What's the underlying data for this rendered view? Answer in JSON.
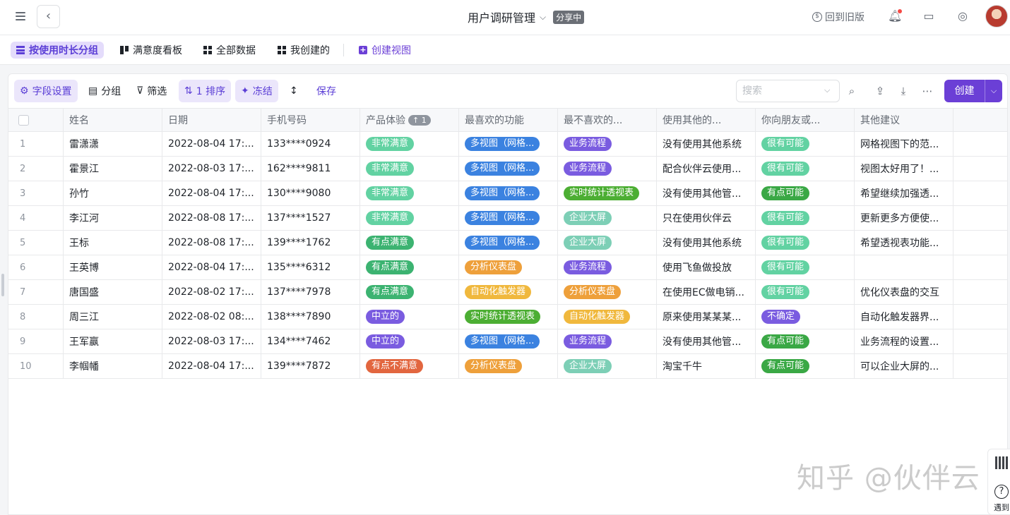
{
  "header": {
    "title": "用户调研管理",
    "share_badge": "分享中",
    "old_version": "回到旧版"
  },
  "views": [
    {
      "label": "按使用时长分组",
      "icon": "grid-icon",
      "active": true
    },
    {
      "label": "满意度看板",
      "icon": "kanban-icon",
      "active": false
    },
    {
      "label": "全部数据",
      "icon": "table-icon",
      "active": false
    },
    {
      "label": "我创建的",
      "icon": "table-icon",
      "active": false
    },
    {
      "label": "创建视图",
      "icon": "plus-icon",
      "active": false
    }
  ],
  "toolbar": {
    "field_settings": "字段设置",
    "group": "分组",
    "filter": "筛选",
    "sort": "1 排序",
    "freeze": "冻结",
    "save": "保存",
    "search_placeholder": "搜索",
    "create": "创建"
  },
  "columns": [
    "姓名",
    "日期",
    "手机号码",
    "产品体验",
    "最喜欢的功能",
    "最不喜欢的...",
    "使用其他的...",
    "你向朋友或...",
    "其他建议"
  ],
  "sort_badge": "↑ 1",
  "tag_colors": {
    "非常满意": "#62d2a2",
    "有点满意": "#3cb371",
    "中立的": "#7a5ce0",
    "有点不满意": "#e2663f",
    "多视图（网格...": "#3b82e0",
    "分析仪表盘": "#eea03b",
    "实时统计透视表": "#4cae33",
    "自动化触发器": "#f0b83d",
    "业务流程": "#7a5ce0",
    "企业大屏": "#7dcfb6",
    "很有可能": "#62d2a2",
    "有点可能": "#3aa845",
    "不确定": "#7a5ce0"
  },
  "rows": [
    {
      "idx": "1",
      "name": "雷潇潇",
      "date": "2022-08-04 17:...",
      "phone": "133****0924",
      "exp": "非常满意",
      "fav": "多视图（网格...",
      "dislike": "业务流程",
      "other": "没有使用其他系统",
      "recommend": "很有可能",
      "suggest": "网格视图下的范..."
    },
    {
      "idx": "2",
      "name": "霍景江",
      "date": "2022-08-03 17:...",
      "phone": "162****9811",
      "exp": "非常满意",
      "fav": "多视图（网格...",
      "dislike": "业务流程",
      "other": "配合伙伴云使用...",
      "recommend": "很有可能",
      "suggest": "视图太好用了！..."
    },
    {
      "idx": "3",
      "name": "孙竹",
      "date": "2022-08-04 17:...",
      "phone": "130****9080",
      "exp": "非常满意",
      "fav": "多视图（网格...",
      "dislike": "实时统计透视表",
      "other": "没有使用其他管...",
      "recommend": "有点可能",
      "suggest": "希望继续加强透..."
    },
    {
      "idx": "4",
      "name": "李江河",
      "date": "2022-08-08 17:...",
      "phone": "137****1527",
      "exp": "非常满意",
      "fav": "多视图（网格...",
      "dislike": "企业大屏",
      "other": "只在使用伙伴云",
      "recommend": "很有可能",
      "suggest": "更新更多方便使..."
    },
    {
      "idx": "5",
      "name": "王标",
      "date": "2022-08-08 17:...",
      "phone": "139****1762",
      "exp": "有点满意",
      "fav": "多视图（网格...",
      "dislike": "企业大屏",
      "other": "没有使用其他系统",
      "recommend": "很有可能",
      "suggest": "希望透视表功能..."
    },
    {
      "idx": "6",
      "name": "王英博",
      "date": "2022-08-04 17:...",
      "phone": "135****6312",
      "exp": "有点满意",
      "fav": "分析仪表盘",
      "dislike": "业务流程",
      "other": "使用飞鱼做投放",
      "recommend": "很有可能",
      "suggest": ""
    },
    {
      "idx": "7",
      "name": "唐国盛",
      "date": "2022-08-02 17:...",
      "phone": "137****7978",
      "exp": "有点满意",
      "fav": "自动化触发器",
      "dislike": "分析仪表盘",
      "other": "在使用EC做电销...",
      "recommend": "很有可能",
      "suggest": "优化仪表盘的交互"
    },
    {
      "idx": "8",
      "name": "周三江",
      "date": "2022-08-02 08:...",
      "phone": "138****7890",
      "exp": "中立的",
      "fav": "实时统计透视表",
      "dislike": "自动化触发器",
      "other": "原来使用某某某...",
      "recommend": "不确定",
      "suggest": "自动化触发器界..."
    },
    {
      "idx": "9",
      "name": "王军赢",
      "date": "2022-08-03 17:...",
      "phone": "134****7462",
      "exp": "中立的",
      "fav": "多视图（网格...",
      "dislike": "业务流程",
      "other": "没有使用其他管...",
      "recommend": "有点可能",
      "suggest": "业务流程的设置..."
    },
    {
      "idx": "10",
      "name": "李帼幡",
      "date": "2022-08-04 17:...",
      "phone": "139****7872",
      "exp": "有点不满意",
      "fav": "分析仪表盘",
      "dislike": "企业大屏",
      "other": "淘宝千牛",
      "recommend": "有点可能",
      "suggest": "可以企业大屏的..."
    }
  ],
  "watermark": "知乎 @伙伴云",
  "float": {
    "help_label": "遇到"
  }
}
